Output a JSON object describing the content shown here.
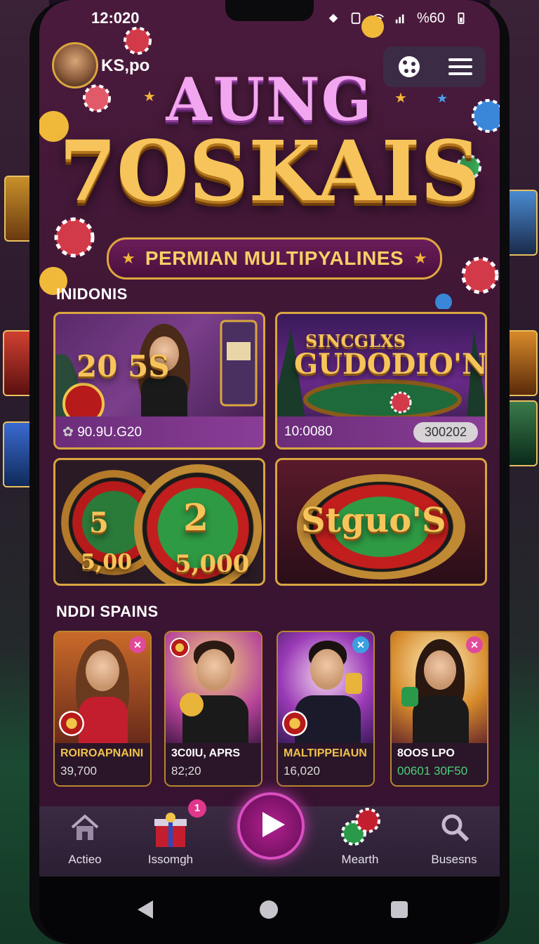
{
  "status": {
    "time": "12:020",
    "battery_text": "%60"
  },
  "user": {
    "name": "KS,po"
  },
  "logo": {
    "line1": "AUNG",
    "line2": "7OSKAIS",
    "banner": "PERMIAN MULTIPYALINES"
  },
  "section1": {
    "title": "INIDONIS",
    "cards": [
      {
        "label": "90.9U.G20",
        "big": "20   5S"
      },
      {
        "label": "10:0080",
        "pill": "300202",
        "big_top": "SINCGLXS",
        "big": "GUDODIO'N"
      },
      {
        "big_a": "5",
        "big_b": "2",
        "sub": "5,00",
        "sub2": "5,000"
      },
      {
        "big": "Stguo'S"
      }
    ]
  },
  "section2": {
    "title": "NDDI SPAINS",
    "cards": [
      {
        "name": "ROIROAPNAINI",
        "value": "39,700"
      },
      {
        "name": "3C0IU, APRS",
        "value": "82;20"
      },
      {
        "name": "MALTIPPEIAUN",
        "value": "16,020"
      },
      {
        "name": "8OOS LPO",
        "value": "00601 30F50"
      }
    ]
  },
  "nav": {
    "items": [
      {
        "label": "Actieo",
        "icon": "home-icon"
      },
      {
        "label": "Issomgh",
        "icon": "gift-icon",
        "badge": "1"
      },
      {
        "label": "",
        "icon": "play-icon"
      },
      {
        "label": "Mearth",
        "icon": "chips-icon"
      },
      {
        "label": "Busesns",
        "icon": "search-icon"
      }
    ]
  },
  "colors": {
    "accent_gold": "#f6c45a",
    "accent_pink": "#d94fc0",
    "bg": "#3d1633"
  }
}
